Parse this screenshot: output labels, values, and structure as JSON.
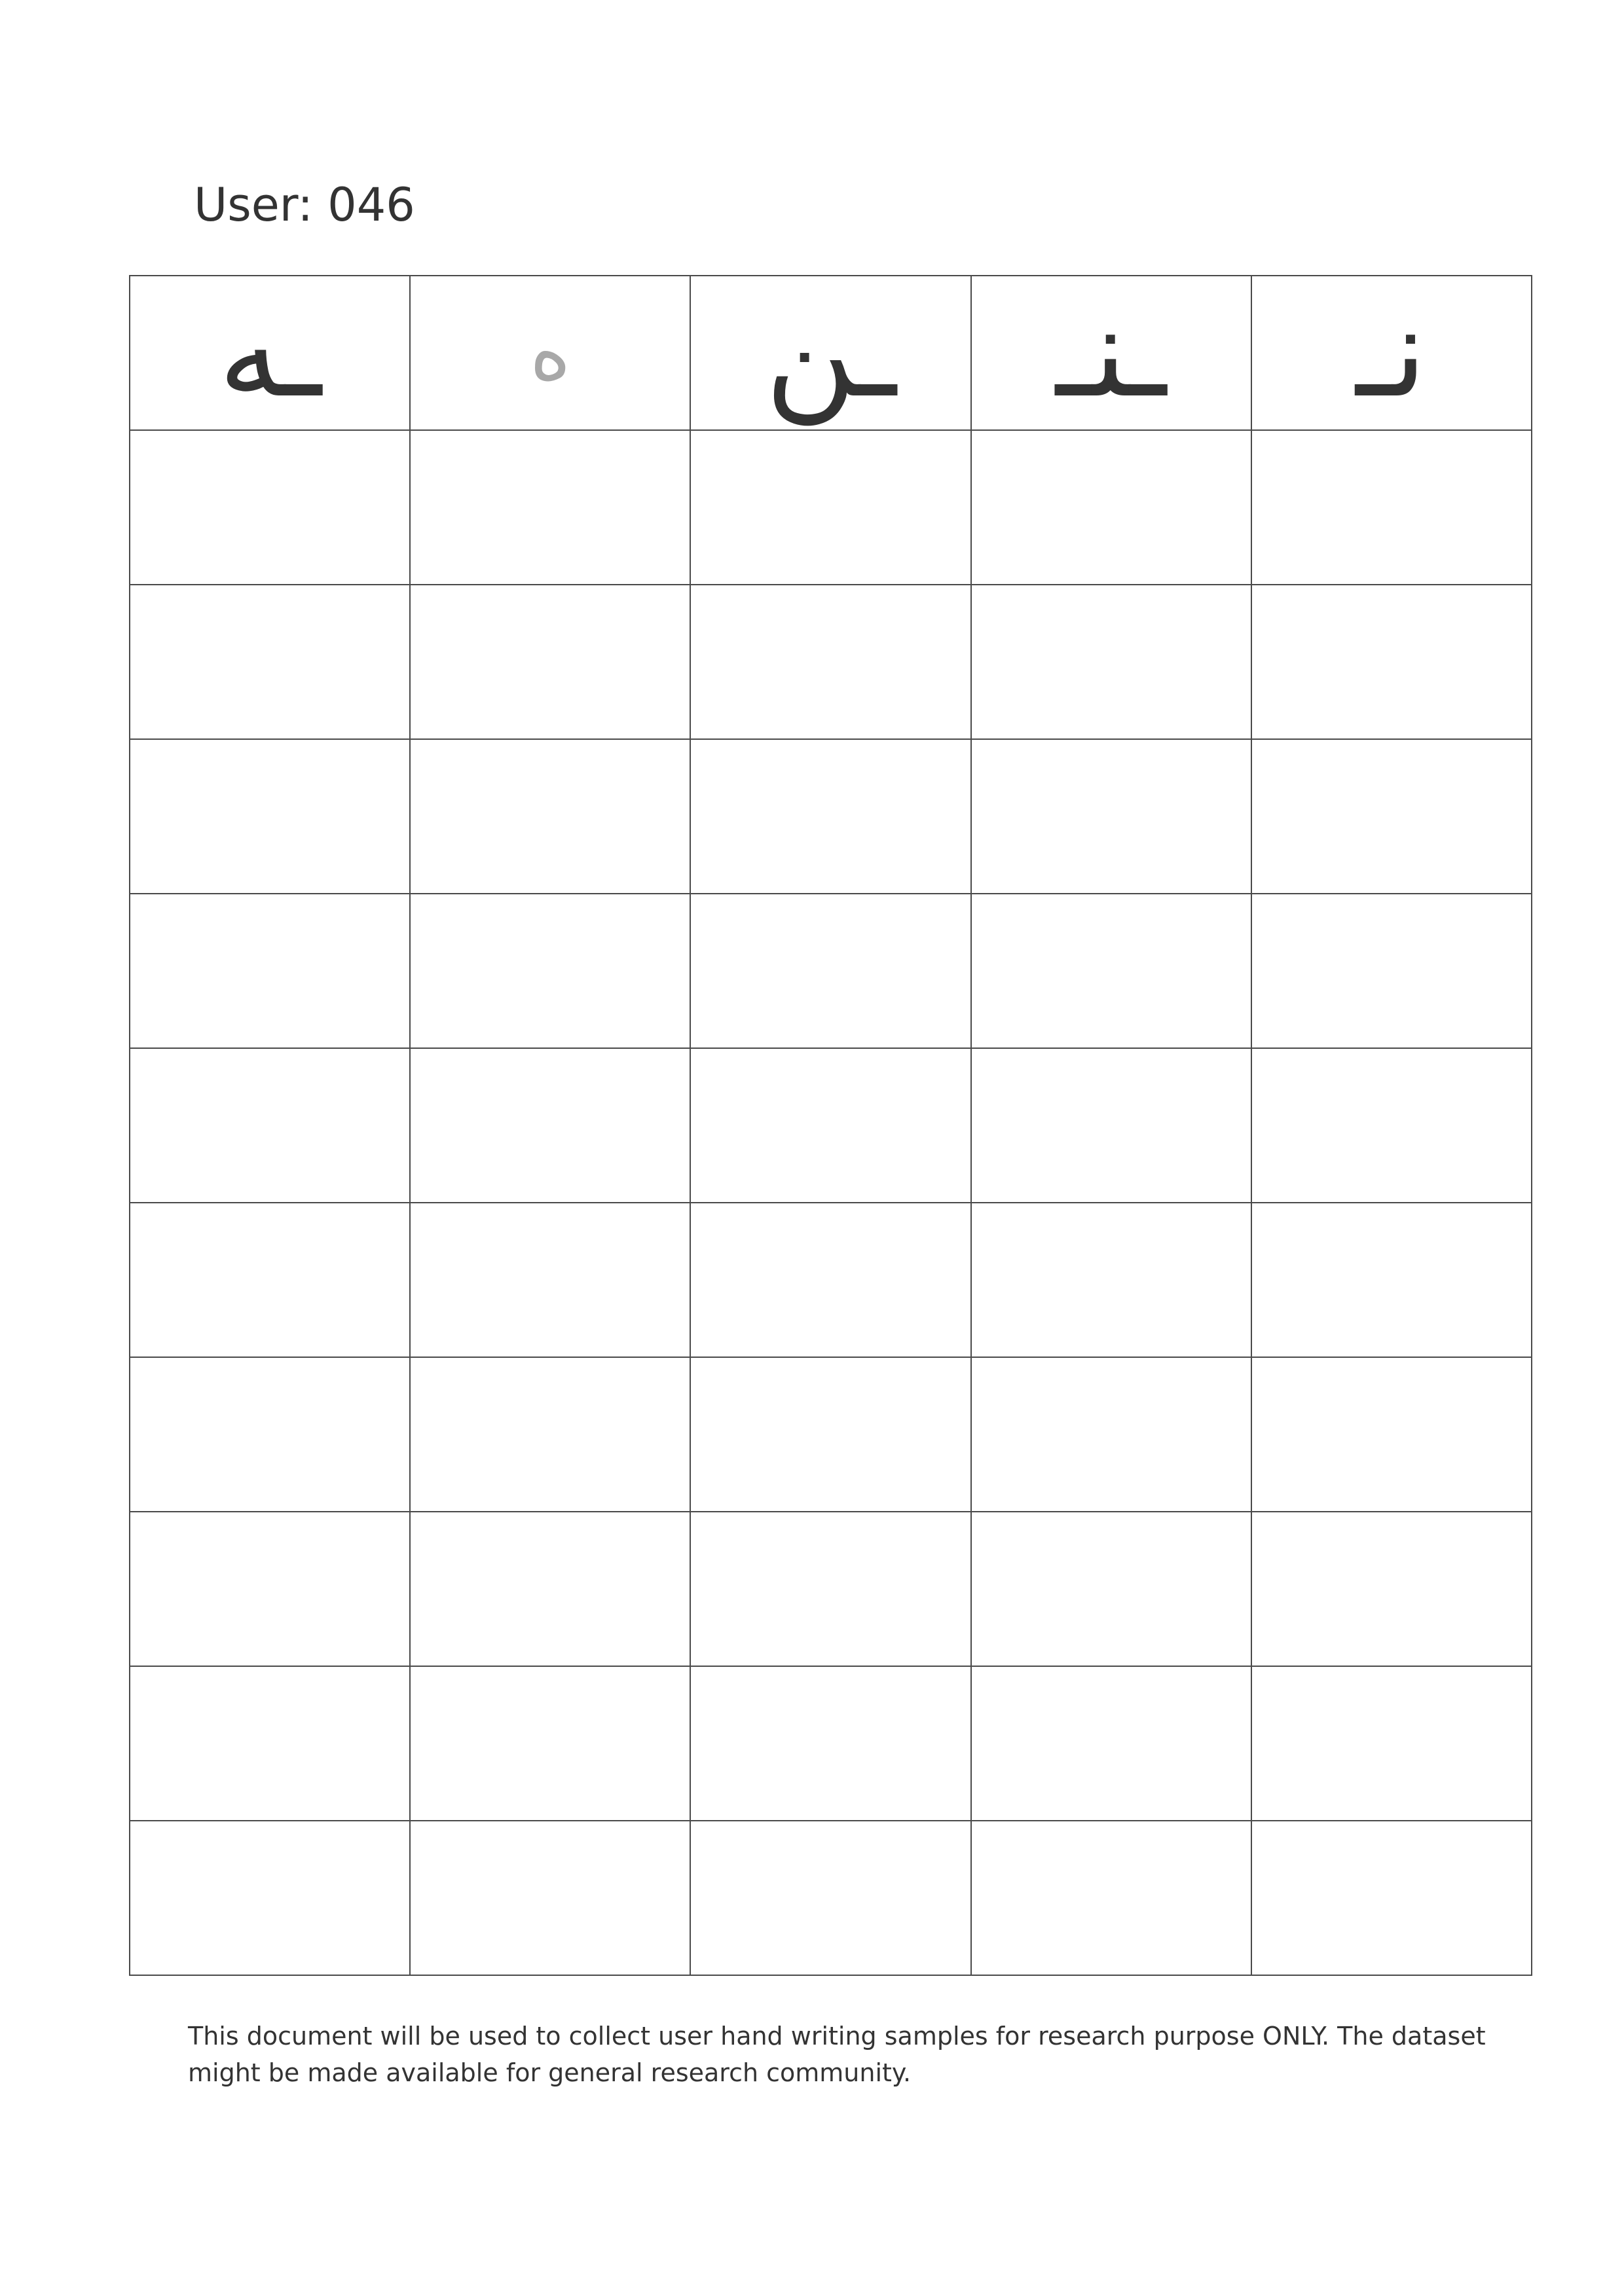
{
  "header": {
    "user_label": "User: 046"
  },
  "grid": {
    "columns": 5,
    "empty_rows": 10,
    "header_letters": [
      {
        "char": "ـه",
        "style": "dark"
      },
      {
        "char": "ه",
        "style": "faded"
      },
      {
        "char": "ـن",
        "style": "dark"
      },
      {
        "char": "ـنـ",
        "style": "dark"
      },
      {
        "char": "نـ",
        "style": "dark"
      }
    ]
  },
  "footer": {
    "notice": "This document will be used to collect user hand writing samples for research purpose ONLY. The dataset might be made available for general research community."
  }
}
